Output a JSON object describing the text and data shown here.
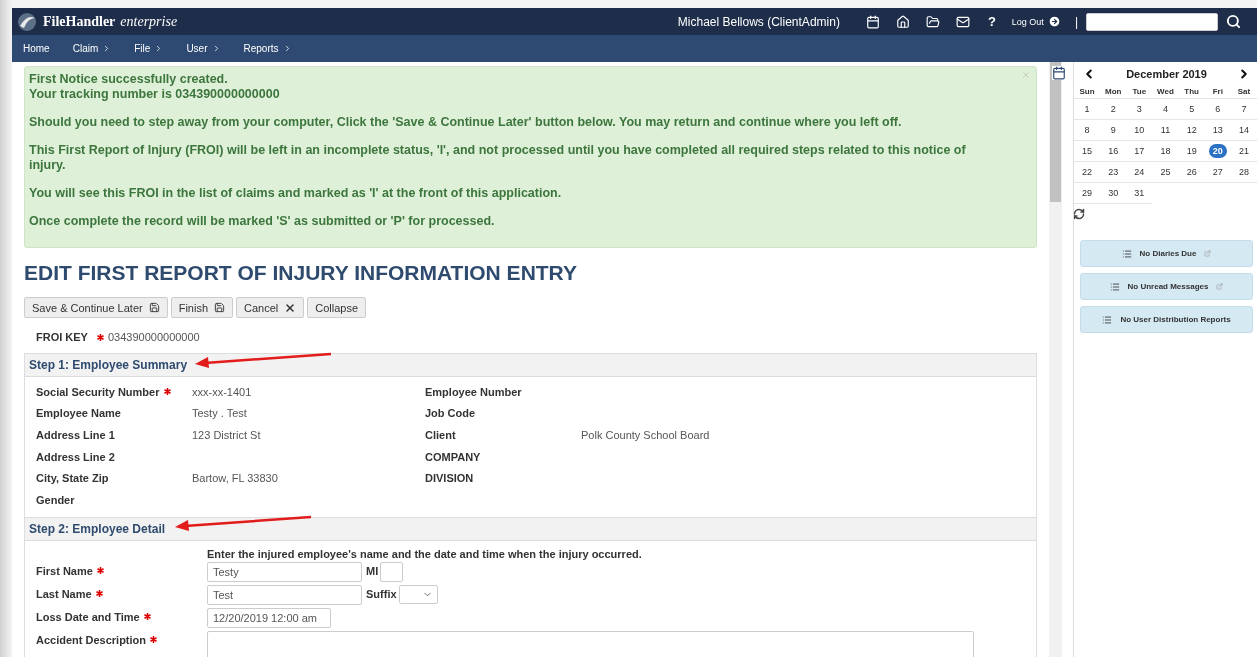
{
  "app": {
    "logo": "FileHandler",
    "logo_suffix": "enterprise"
  },
  "header": {
    "user": "Michael Bellows (ClientAdmin)",
    "help": "?",
    "logout": "Log Out",
    "separator": "|"
  },
  "nav": [
    {
      "label": "Home",
      "menu": false
    },
    {
      "label": "Claim",
      "menu": true
    },
    {
      "label": "File",
      "menu": true
    },
    {
      "label": "User",
      "menu": true
    },
    {
      "label": "Reports",
      "menu": true
    }
  ],
  "alert": {
    "paragraphs": [
      [
        "First Notice successfully created.",
        "Your tracking number is 034390000000000"
      ],
      [
        "Should you need to step away from your computer, Click the 'Save & Continue Later' button below. You may return and continue where you left off."
      ],
      [
        "This First Report of Injury (FROI) will be left in an incomplete status, 'I', and not processed until you have completed all required steps related to this notice of injury."
      ],
      [
        "You will see this FROI in the list of claims and marked as 'I' at the front of this application."
      ],
      [
        "Once complete the record will be marked 'S' as submitted or 'P' for processed."
      ]
    ]
  },
  "title": "EDIT FIRST REPORT OF INJURY INFORMATION ENTRY",
  "buttons": [
    {
      "label": "Save & Continue Later",
      "kind": "save"
    },
    {
      "label": "Finish",
      "kind": "save"
    },
    {
      "label": "Cancel",
      "kind": "cancel"
    },
    {
      "label": "Collapse",
      "kind": "plain"
    }
  ],
  "froi_key": {
    "label": "FROI KEY",
    "required": true,
    "value": "034390000000000"
  },
  "step1": {
    "title": "Step 1: Employee Summary",
    "rows": [
      {
        "label": "Social Security Number",
        "required": true,
        "value": "xxx-xx-1401",
        "label_2": "Employee Number"
      },
      {
        "label": "Employee Name",
        "required": false,
        "value": "Testy . Test",
        "label_2": "Job Code"
      },
      {
        "label": "Address Line 1",
        "required": false,
        "value": "123 District St",
        "label_2": "Client",
        "value_2": "Polk County School Board"
      },
      {
        "label": "Address Line 2",
        "required": false,
        "label_2": "COMPANY"
      },
      {
        "label": "City, State Zip",
        "required": false,
        "value": "Bartow, FL 33830",
        "label_2": "DIVISION"
      },
      {
        "label": "Gender",
        "required": false
      }
    ]
  },
  "step2": {
    "title": "Step 2: Employee Detail",
    "intro": "Enter the injured employee's name and the date and time when the injury occurred.",
    "fields": [
      {
        "label": "First Name",
        "required": true,
        "kind": "text",
        "value": "Testy",
        "extra": {
          "label": "MI",
          "kind": "text"
        }
      },
      {
        "label": "Last Name",
        "required": true,
        "kind": "text",
        "value": "Test",
        "extra": {
          "label": "Suffix",
          "kind": "select"
        }
      },
      {
        "label": "Loss Date and Time",
        "required": true,
        "kind": "date",
        "value": "12/20/2019 12:00 am"
      },
      {
        "label": "Accident Description",
        "required": true,
        "kind": "textarea"
      }
    ]
  },
  "calendar": {
    "month": "December 2019",
    "weekdays": [
      "Sun",
      "Mon",
      "Tue",
      "Wed",
      "Thu",
      "Fri",
      "Sat"
    ],
    "days": [
      {
        "day": "1",
        "selected": false
      },
      {
        "day": "2",
        "selected": false
      },
      {
        "day": "3",
        "selected": false
      },
      {
        "day": "4",
        "selected": false
      },
      {
        "day": "5",
        "selected": false
      },
      {
        "day": "6",
        "selected": false
      },
      {
        "day": "7",
        "selected": false
      },
      {
        "day": "8",
        "selected": false
      },
      {
        "day": "9",
        "selected": false
      },
      {
        "day": "10",
        "selected": false
      },
      {
        "day": "11",
        "selected": false
      },
      {
        "day": "12",
        "selected": false
      },
      {
        "day": "13",
        "selected": false
      },
      {
        "day": "14",
        "selected": false
      },
      {
        "day": "15",
        "selected": false
      },
      {
        "day": "16",
        "selected": false
      },
      {
        "day": "17",
        "selected": false
      },
      {
        "day": "18",
        "selected": false
      },
      {
        "day": "19",
        "selected": false
      },
      {
        "day": "20",
        "selected": true
      },
      {
        "day": "21",
        "selected": false
      },
      {
        "day": "22",
        "selected": false
      },
      {
        "day": "23",
        "selected": false
      },
      {
        "day": "24",
        "selected": false
      },
      {
        "day": "25",
        "selected": false
      },
      {
        "day": "26",
        "selected": false
      },
      {
        "day": "27",
        "selected": false
      },
      {
        "day": "28",
        "selected": false
      },
      {
        "day": "29",
        "selected": false
      },
      {
        "day": "30",
        "selected": false
      },
      {
        "day": "31",
        "selected": false
      }
    ]
  },
  "panels": [
    {
      "label": "No Diaries Due",
      "external": true
    },
    {
      "label": "No Unread Messages",
      "external": true
    },
    {
      "label": "No User Distribution Reports",
      "external": false
    }
  ]
}
